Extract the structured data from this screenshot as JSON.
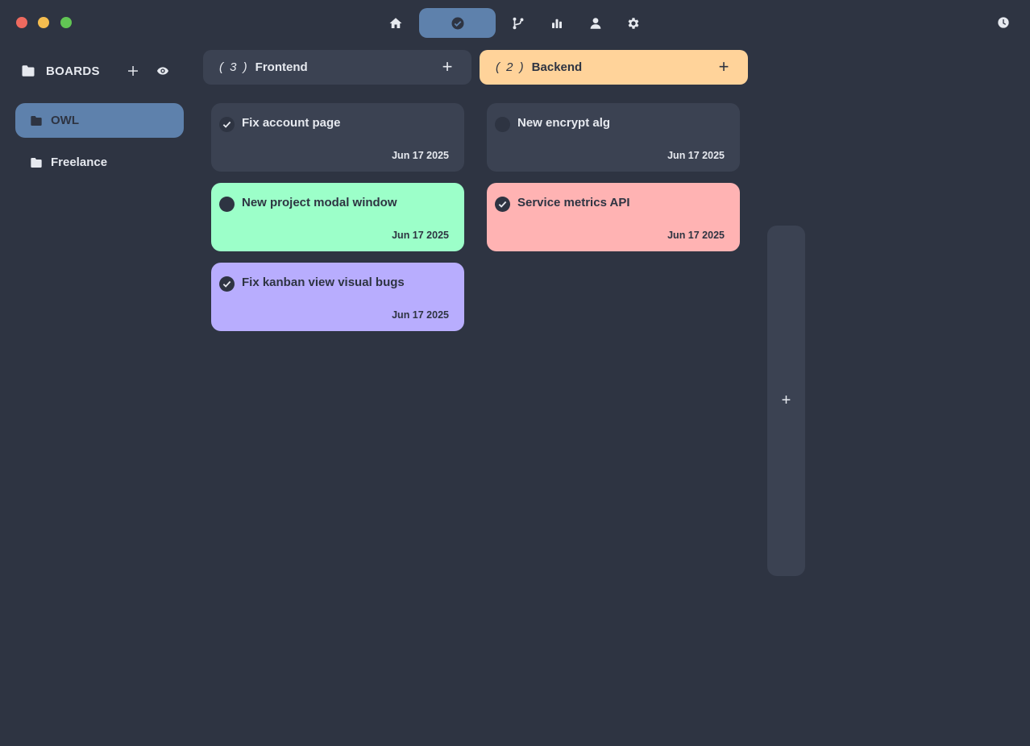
{
  "window": {
    "controls": [
      "close",
      "minimize",
      "maximize"
    ],
    "colors": {
      "close": "#ee6a5f",
      "minimize": "#f5bd4f",
      "maximize": "#61c554"
    }
  },
  "nav": {
    "items": [
      {
        "icon": "home-icon",
        "active": false
      },
      {
        "icon": "check-circle-icon",
        "active": true
      },
      {
        "icon": "git-branch-icon",
        "active": false
      },
      {
        "icon": "bar-chart-icon",
        "active": false
      },
      {
        "icon": "user-icon",
        "active": false
      },
      {
        "icon": "gear-icon",
        "active": false
      }
    ],
    "right_icon": "clock-icon",
    "active_color": "#5e81ac"
  },
  "sidebar": {
    "title": "BOARDS",
    "boards": [
      {
        "label": "OWL",
        "active": true
      },
      {
        "label": "Freelance",
        "active": false
      }
    ]
  },
  "columns": [
    {
      "count": "( 3 )",
      "title": "Frontend",
      "color": "#3b4252",
      "cards": [
        {
          "title": "Fix account page",
          "date": "Jun 17 2025",
          "done": true,
          "color": "#3b4252"
        },
        {
          "title": "New project modal window",
          "date": "Jun 17 2025",
          "done": false,
          "color": "#9cffc9"
        },
        {
          "title": "Fix kanban view visual bugs",
          "date": "Jun 17 2025",
          "done": true,
          "color": "#b8adfe"
        }
      ]
    },
    {
      "count": "( 2 )",
      "title": "Backend",
      "color": "#ffd39a",
      "cards": [
        {
          "title": "New encrypt alg",
          "date": "Jun 17 2025",
          "done": false,
          "color": "#3b4252"
        },
        {
          "title": "Service metrics API",
          "date": "Jun 17 2025",
          "done": true,
          "color": "#ffb3b3"
        }
      ]
    }
  ],
  "add_column_label": "+",
  "add_label": "+"
}
